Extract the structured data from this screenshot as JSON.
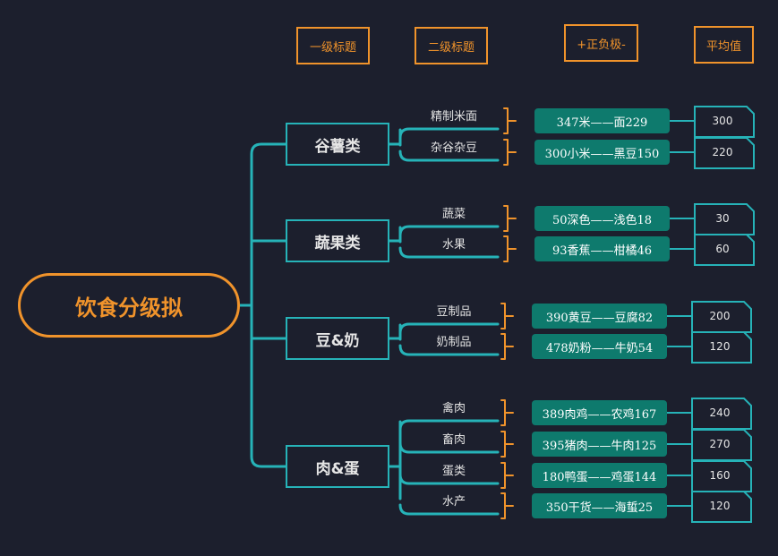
{
  "headers": {
    "level1": "一级标题",
    "level2": "二级标题",
    "range": "+正负极-",
    "average": "平均值"
  },
  "root": {
    "title": "饮食分级拟"
  },
  "categories": [
    {
      "name": "谷薯类",
      "items": [
        {
          "name": "精制米面",
          "range": "347米——面229",
          "avg": "300"
        },
        {
          "name": "杂谷杂豆",
          "range": "300小米——黑豆150",
          "avg": "220"
        }
      ]
    },
    {
      "name": "蔬果类",
      "items": [
        {
          "name": "蔬菜",
          "range": "50深色——浅色18",
          "avg": "30"
        },
        {
          "name": "水果",
          "range": "93香蕉——柑橘46",
          "avg": "60"
        }
      ]
    },
    {
      "name": "豆&奶",
      "items": [
        {
          "name": "豆制品",
          "range": "390黄豆——豆腐82",
          "avg": "200"
        },
        {
          "name": "奶制品",
          "range": "478奶粉——牛奶54",
          "avg": "120"
        }
      ]
    },
    {
      "name": "肉&蛋",
      "items": [
        {
          "name": "禽肉",
          "range": "389肉鸡——农鸡167",
          "avg": "240"
        },
        {
          "name": "畜肉",
          "range": "395猪肉——牛肉125",
          "avg": "270"
        },
        {
          "name": "蛋类",
          "range": "180鸭蛋——鸡蛋144",
          "avg": "160"
        },
        {
          "name": "水产",
          "range": "350干货——海蜇25",
          "avg": "120"
        }
      ]
    }
  ],
  "colors": {
    "background": "#1c1f2d",
    "teal": "#26b3b8",
    "orange": "#f0932b",
    "range_fill": "#0e7a6d"
  }
}
